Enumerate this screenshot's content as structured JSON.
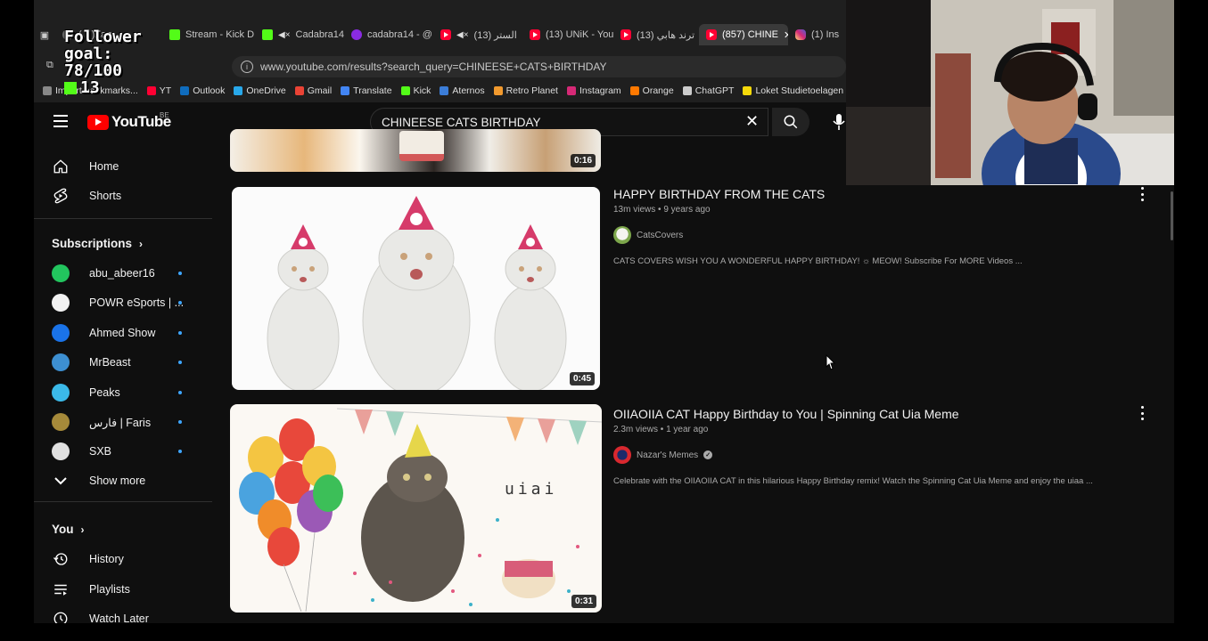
{
  "browser": {
    "tabs": [
      {
        "label": "(…)Zam",
        "icon": "generic",
        "muted": false,
        "active": false
      },
      {
        "label": "Stream - Kick D",
        "icon": "kick",
        "muted": false,
        "active": false
      },
      {
        "label": "Cadabra14",
        "icon": "kick",
        "muted": true,
        "active": false
      },
      {
        "label": "cadabra14 - @",
        "icon": "threads",
        "muted": false,
        "active": false
      },
      {
        "label": "الستر (13)",
        "icon": "youtube",
        "muted": true,
        "active": false
      },
      {
        "label": "(13) UNiK - You",
        "icon": "youtube",
        "muted": false,
        "active": false
      },
      {
        "label": "(13) ترند هابي",
        "icon": "youtube",
        "muted": false,
        "active": false
      },
      {
        "label": "(857) CHINE",
        "icon": "youtube",
        "muted": false,
        "active": true
      },
      {
        "label": "(1) Ins",
        "icon": "instagram",
        "muted": false,
        "active": false
      }
    ],
    "url": "www.youtube.com/results?search_query=CHINEESE+CATS+BIRTHDAY",
    "bookmarks": [
      {
        "label": "Import bookmarks...",
        "color": "#888"
      },
      {
        "label": "YT",
        "color": "#ff0033"
      },
      {
        "label": "Outlook",
        "color": "#0f6cbd"
      },
      {
        "label": "OneDrive",
        "color": "#28a8ea"
      },
      {
        "label": "Gmail",
        "color": "#ea4335"
      },
      {
        "label": "Translate",
        "color": "#4285f4"
      },
      {
        "label": "Kick",
        "color": "#53fc18"
      },
      {
        "label": "Aternos",
        "color": "#3b7dd8"
      },
      {
        "label": "Retro Planet",
        "color": "#f29a2e"
      },
      {
        "label": "Instagram",
        "color": "#d62976"
      },
      {
        "label": "Orange",
        "color": "#ff7900"
      },
      {
        "label": "ChatGPT",
        "color": "#cccccc"
      },
      {
        "label": "Loket Studietoelagen",
        "color": "#f5d90a"
      }
    ]
  },
  "overlay": {
    "line1": "Follower",
    "line2": "goal:",
    "line3": "78/100",
    "line4": "13"
  },
  "youtube": {
    "logo_text": "YouTube",
    "country_code": "BE",
    "search_query": "CHINEESE CATS BIRTHDAY",
    "sidebar": {
      "home": "Home",
      "shorts": "Shorts",
      "subscriptions_heading": "Subscriptions",
      "subscriptions": [
        {
          "name": "abu_abeer16",
          "color": "#22c55e"
        },
        {
          "name": "POWR eSports | ...",
          "color": "#f2f2f2"
        },
        {
          "name": "Ahmed Show",
          "color": "#1a73e8"
        },
        {
          "name": "MrBeast",
          "color": "#3d8fd1"
        },
        {
          "name": "Peaks",
          "color": "#3bb9e8"
        },
        {
          "name": "فارس | Faris",
          "color": "#a68a3a"
        },
        {
          "name": "SXB",
          "color": "#e0e0e0"
        }
      ],
      "show_more": "Show more",
      "you_heading": "You",
      "history": "History",
      "playlists": "Playlists",
      "watch_later": "Watch Later"
    },
    "results": [
      {
        "duration": "0:16"
      },
      {
        "title": "HAPPY BIRTHDAY FROM THE CATS",
        "views": "13m views",
        "age": "9 years ago",
        "channel": "CatsCovers",
        "verified": false,
        "description": "CATS COVERS WISH YOU A WONDERFUL HAPPY BIRTHDAY! ☼ MEOW! Subscribe For MORE Videos ...",
        "duration": "0:45"
      },
      {
        "title": "OIIAOIIA CAT Happy Birthday to You | Spinning Cat Uia Meme",
        "views": "2.3m views",
        "age": "1 year ago",
        "channel": "Nazar's Memes",
        "verified": true,
        "description": "Celebrate with the OIIAOIIA CAT in this hilarious Happy Birthday remix! Watch the Spinning Cat Uia Meme and enjoy the uiaa ...",
        "duration": "0:31",
        "thumb_text": "uiai"
      }
    ]
  },
  "colors": {
    "yt_bg": "#0f0f0f",
    "accent": "#ff0000",
    "subscribed_dot": "#3ea6ff"
  }
}
